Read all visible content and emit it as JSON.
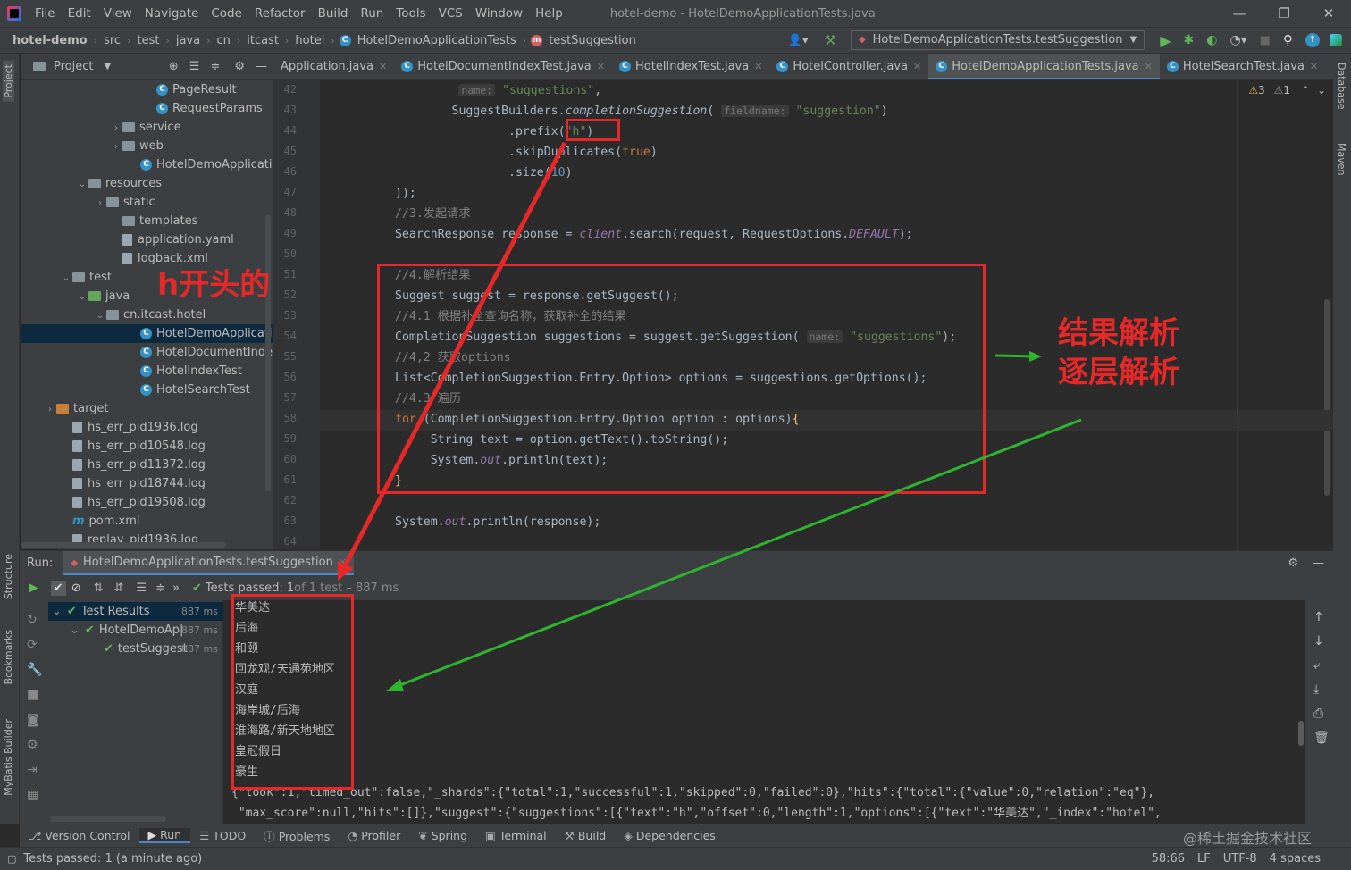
{
  "menu": {
    "items": [
      "File",
      "Edit",
      "View",
      "Navigate",
      "Code",
      "Refactor",
      "Build",
      "Run",
      "Tools",
      "VCS",
      "Window",
      "Help"
    ],
    "title": "hotel-demo - HotelDemoApplicationTests.java"
  },
  "breadcrumb": [
    "hotel-demo",
    "src",
    "test",
    "java",
    "cn",
    "itcast",
    "hotel",
    "HotelDemoApplicationTests",
    "testSuggestion"
  ],
  "run_config": "HotelDemoApplicationTests.testSuggestion",
  "project": {
    "title": "Project",
    "tree": [
      {
        "label": "PageResult",
        "indent": 138,
        "icon": "class"
      },
      {
        "label": "RequestParams",
        "indent": 138,
        "icon": "class"
      },
      {
        "label": "service",
        "indent": 100,
        "icon": "folder",
        "arrow": "›"
      },
      {
        "label": "web",
        "indent": 100,
        "icon": "folder",
        "arrow": "›"
      },
      {
        "label": "HotelDemoApplication",
        "indent": 120,
        "icon": "class"
      },
      {
        "label": "resources",
        "indent": 62,
        "icon": "folder",
        "arrow": "⌄"
      },
      {
        "label": "static",
        "indent": 82,
        "icon": "folder",
        "arrow": "›"
      },
      {
        "label": "templates",
        "indent": 100,
        "icon": "folder"
      },
      {
        "label": "application.yaml",
        "indent": 100,
        "icon": "file"
      },
      {
        "label": "logback.xml",
        "indent": 100,
        "icon": "file"
      },
      {
        "label": "test",
        "indent": 44,
        "icon": "folder",
        "arrow": "⌄"
      },
      {
        "label": "java",
        "indent": 62,
        "icon": "folder-green",
        "arrow": "⌄"
      },
      {
        "label": "cn.itcast.hotel",
        "indent": 82,
        "icon": "folder",
        "arrow": "⌄"
      },
      {
        "label": "HotelDemoApplication",
        "indent": 120,
        "icon": "class",
        "selected": true
      },
      {
        "label": "HotelDocumentIndexTe",
        "indent": 120,
        "icon": "class"
      },
      {
        "label": "HotelIndexTest",
        "indent": 120,
        "icon": "class"
      },
      {
        "label": "HotelSearchTest",
        "indent": 120,
        "icon": "class"
      },
      {
        "label": "target",
        "indent": 26,
        "icon": "folder-orange",
        "arrow": "›"
      },
      {
        "label": "hs_err_pid1936.log",
        "indent": 44,
        "icon": "file"
      },
      {
        "label": "hs_err_pid10548.log",
        "indent": 44,
        "icon": "file"
      },
      {
        "label": "hs_err_pid11372.log",
        "indent": 44,
        "icon": "file"
      },
      {
        "label": "hs_err_pid18744.log",
        "indent": 44,
        "icon": "file"
      },
      {
        "label": "hs_err_pid19508.log",
        "indent": 44,
        "icon": "file"
      },
      {
        "label": "pom.xml",
        "indent": 44,
        "icon": "maven"
      },
      {
        "label": "replay_pid1936.log",
        "indent": 44,
        "icon": "file"
      }
    ]
  },
  "tabs": [
    {
      "label": "Application.java",
      "active": false
    },
    {
      "label": "HotelDocumentIndexTest.java",
      "active": false
    },
    {
      "label": "HotelIndexTest.java",
      "active": false
    },
    {
      "label": "HotelController.java",
      "active": false
    },
    {
      "label": "HotelDemoApplicationTests.java",
      "active": true
    },
    {
      "label": "HotelSearchTest.java",
      "active": false
    }
  ],
  "inspections": {
    "warnings": "3",
    "weak": "1"
  },
  "code": {
    "lines": [
      "42",
      "43",
      "44",
      "45",
      "46",
      "47",
      "48",
      "49",
      "50",
      "51",
      "52",
      "53",
      "54",
      "55",
      "56",
      "57",
      "58",
      "59",
      "60",
      "61",
      "62",
      "63",
      "64"
    ]
  },
  "run": {
    "label": "Run:",
    "tab": "HotelDemoApplicationTests.testSuggestion",
    "status": "Tests passed: 1",
    "status_suffix": " of 1 test – 887 ms",
    "tree": [
      {
        "label": "Test Results",
        "time": "887 ms"
      },
      {
        "label": "HotelDemoAp|",
        "time": "887 ms"
      },
      {
        "label": "testSuggest",
        "time": "887 ms"
      }
    ],
    "output": [
      "华美达",
      "后海",
      "和颐",
      "回龙观/天通苑地区",
      "汉庭",
      "海岸城/后海",
      "淮海路/新天地地区",
      "皇冠假日",
      "豪生"
    ],
    "json_line1": "{\"took\":1,\"timed_out\":false,\"_shards\":{\"total\":1,\"successful\":1,\"skipped\":0,\"failed\":0},\"hits\":{\"total\":{\"value\":0,\"relation\":\"eq\"},",
    "json_line2": " \"max_score\":null,\"hits\":[]},\"suggest\":{\"suggestions\":[{\"text\":\"h\",\"offset\":0,\"length\":1,\"options\":[{\"text\":\"华美达\",\"_index\":\"hotel\","
  },
  "bottom_tabs": [
    "Version Control",
    "Run",
    "TODO",
    "Problems",
    "Profiler",
    "Spring",
    "Terminal",
    "Build",
    "Dependencies"
  ],
  "status": {
    "message": "Tests passed: 1 (a minute ago)",
    "position": "58:66",
    "line_sep": "LF",
    "encoding": "UTF-8",
    "indent": "4 spaces",
    "watermark": "@稀土掘金技术社区"
  },
  "side_tabs": {
    "left": [
      "Project",
      "Structure",
      "Bookmarks",
      "MyBatis Builder"
    ],
    "right": [
      "Database",
      "Maven"
    ]
  },
  "annotations": {
    "h_prefix": "h开头的",
    "result_parse_1": "结果解析",
    "result_parse_2": "逐层解析"
  },
  "colors": {
    "accent": "#4a88c7",
    "annotation_red": "#e62828",
    "annotation_green": "#2db52d",
    "success": "#5fb85a"
  }
}
